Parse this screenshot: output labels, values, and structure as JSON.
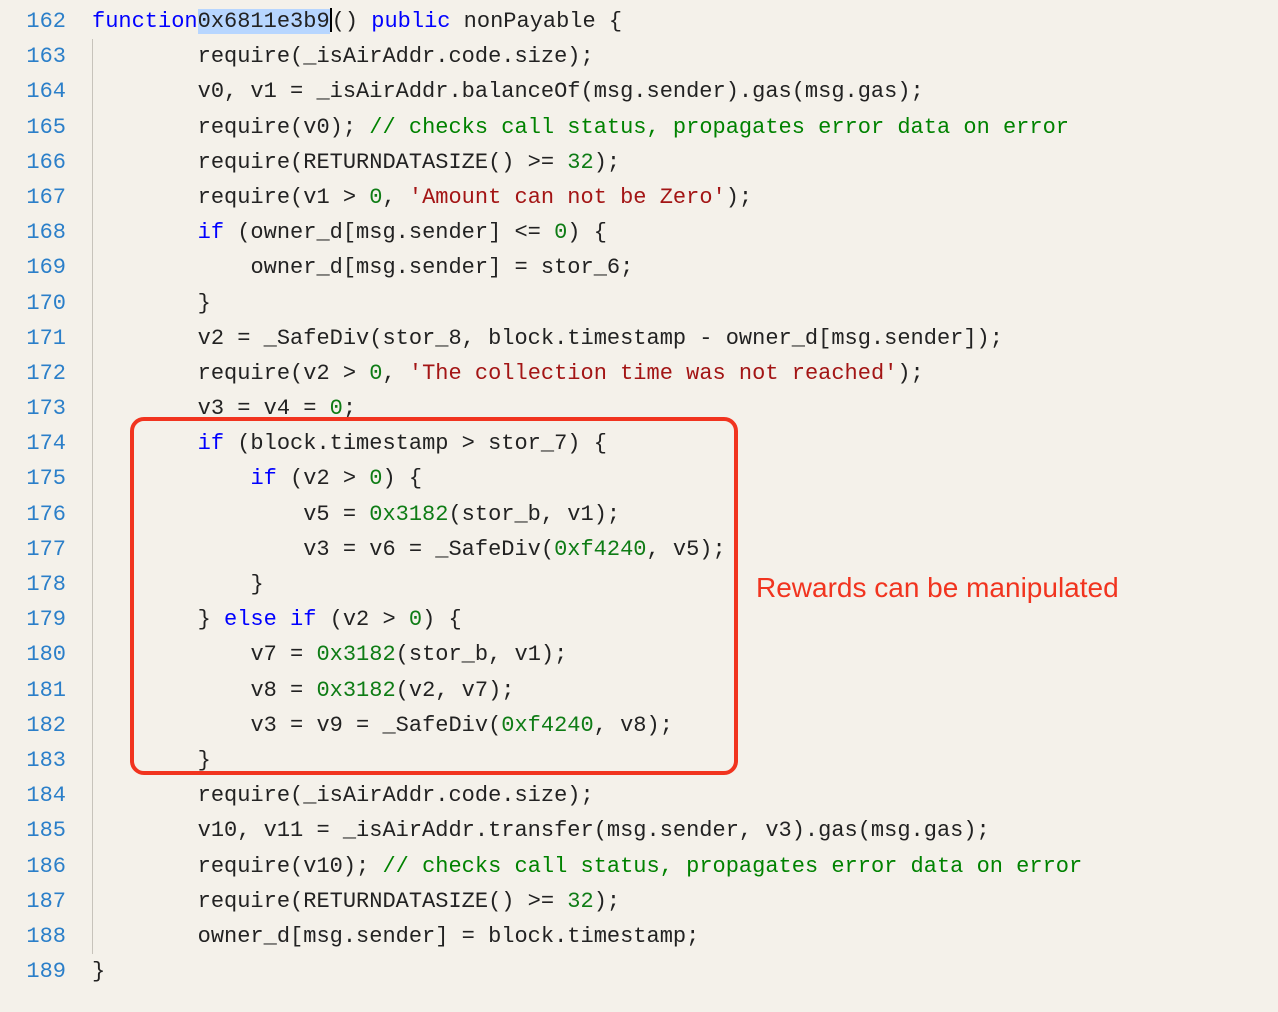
{
  "lines": [
    {
      "n": "162",
      "indent": 0,
      "tokens": [
        [
          "kw",
          "function"
        ],
        [
          "",
          ""
        ],
        [
          "fname sel",
          "0x6811e3b9"
        ],
        [
          "cursor",
          ""
        ],
        [
          "",
          "() "
        ],
        [
          "kw",
          "public"
        ],
        [
          "",
          " nonPayable {"
        ]
      ]
    },
    {
      "n": "163",
      "indent": 2,
      "tokens": [
        [
          "",
          "require(_isAirAddr.code.size);"
        ]
      ]
    },
    {
      "n": "164",
      "indent": 2,
      "tokens": [
        [
          "",
          "v0, v1 = _isAirAddr.balanceOf(msg.sender).gas(msg.gas);"
        ]
      ]
    },
    {
      "n": "165",
      "indent": 2,
      "tokens": [
        [
          "",
          "require(v0); "
        ],
        [
          "cmt",
          "// checks call status, propagates error data on error"
        ]
      ]
    },
    {
      "n": "166",
      "indent": 2,
      "tokens": [
        [
          "",
          "require(RETURNDATASIZE() >= "
        ],
        [
          "num",
          "32"
        ],
        [
          "",
          ");"
        ]
      ]
    },
    {
      "n": "167",
      "indent": 2,
      "tokens": [
        [
          "",
          "require(v1 > "
        ],
        [
          "num",
          "0"
        ],
        [
          "",
          ", "
        ],
        [
          "str",
          "'Amount can not be Zero'"
        ],
        [
          "",
          ");"
        ]
      ]
    },
    {
      "n": "168",
      "indent": 2,
      "tokens": [
        [
          "kw",
          "if"
        ],
        [
          "",
          " (owner_d[msg.sender] <= "
        ],
        [
          "num",
          "0"
        ],
        [
          "",
          ") {"
        ]
      ]
    },
    {
      "n": "169",
      "indent": 3,
      "tokens": [
        [
          "",
          "owner_d[msg.sender] = stor_6;"
        ]
      ]
    },
    {
      "n": "170",
      "indent": 2,
      "tokens": [
        [
          "",
          "}"
        ]
      ]
    },
    {
      "n": "171",
      "indent": 2,
      "tokens": [
        [
          "",
          "v2 = _SafeDiv(stor_8, block.timestamp - owner_d[msg.sender]);"
        ]
      ]
    },
    {
      "n": "172",
      "indent": 2,
      "tokens": [
        [
          "",
          "require(v2 > "
        ],
        [
          "num",
          "0"
        ],
        [
          "",
          ", "
        ],
        [
          "str",
          "'The collection time was not reached'"
        ],
        [
          "",
          ");"
        ]
      ]
    },
    {
      "n": "173",
      "indent": 2,
      "tokens": [
        [
          "",
          "v3 = v4 = "
        ],
        [
          "num",
          "0"
        ],
        [
          "",
          ";"
        ]
      ]
    },
    {
      "n": "174",
      "indent": 2,
      "tokens": [
        [
          "kw",
          "if"
        ],
        [
          "",
          " (block.timestamp > stor_7) {"
        ]
      ]
    },
    {
      "n": "175",
      "indent": 3,
      "tokens": [
        [
          "kw",
          "if"
        ],
        [
          "",
          " (v2 > "
        ],
        [
          "num",
          "0"
        ],
        [
          "",
          ") {"
        ]
      ]
    },
    {
      "n": "176",
      "indent": 4,
      "tokens": [
        [
          "",
          "v5 = "
        ],
        [
          "num",
          "0x3182"
        ],
        [
          "",
          "(stor_b, v1);"
        ]
      ]
    },
    {
      "n": "177",
      "indent": 4,
      "tokens": [
        [
          "",
          "v3 = v6 = _SafeDiv("
        ],
        [
          "num",
          "0xf4240"
        ],
        [
          "",
          ", v5);"
        ]
      ]
    },
    {
      "n": "178",
      "indent": 3,
      "tokens": [
        [
          "",
          "}"
        ]
      ]
    },
    {
      "n": "179",
      "indent": 2,
      "tokens": [
        [
          "",
          "} "
        ],
        [
          "kw",
          "else"
        ],
        [
          "",
          " "
        ],
        [
          "kw",
          "if"
        ],
        [
          "",
          " (v2 > "
        ],
        [
          "num",
          "0"
        ],
        [
          "",
          ") {"
        ]
      ]
    },
    {
      "n": "180",
      "indent": 3,
      "tokens": [
        [
          "",
          "v7 = "
        ],
        [
          "num",
          "0x3182"
        ],
        [
          "",
          "(stor_b, v1);"
        ]
      ]
    },
    {
      "n": "181",
      "indent": 3,
      "tokens": [
        [
          "",
          "v8 = "
        ],
        [
          "num",
          "0x3182"
        ],
        [
          "",
          "(v2, v7);"
        ]
      ]
    },
    {
      "n": "182",
      "indent": 3,
      "tokens": [
        [
          "",
          "v3 = v9 = _SafeDiv("
        ],
        [
          "num",
          "0xf4240"
        ],
        [
          "",
          ", v8);"
        ]
      ]
    },
    {
      "n": "183",
      "indent": 2,
      "tokens": [
        [
          "",
          "}"
        ]
      ]
    },
    {
      "n": "184",
      "indent": 2,
      "tokens": [
        [
          "",
          "require(_isAirAddr.code.size);"
        ]
      ]
    },
    {
      "n": "185",
      "indent": 2,
      "tokens": [
        [
          "",
          "v10, v11 = _isAirAddr.transfer(msg.sender, v3).gas(msg.gas);"
        ]
      ]
    },
    {
      "n": "186",
      "indent": 2,
      "tokens": [
        [
          "",
          "require(v10); "
        ],
        [
          "cmt",
          "// checks call status, propagates error data on error"
        ]
      ]
    },
    {
      "n": "187",
      "indent": 2,
      "tokens": [
        [
          "",
          "require(RETURNDATASIZE() >= "
        ],
        [
          "num",
          "32"
        ],
        [
          "",
          ");"
        ]
      ]
    },
    {
      "n": "188",
      "indent": 2,
      "tokens": [
        [
          "",
          "owner_d[msg.sender] = block.timestamp;"
        ]
      ]
    },
    {
      "n": "189",
      "indent": 0,
      "tokens": [
        [
          "",
          "}"
        ]
      ]
    }
  ],
  "annotation": "Rewards can be manipulated"
}
